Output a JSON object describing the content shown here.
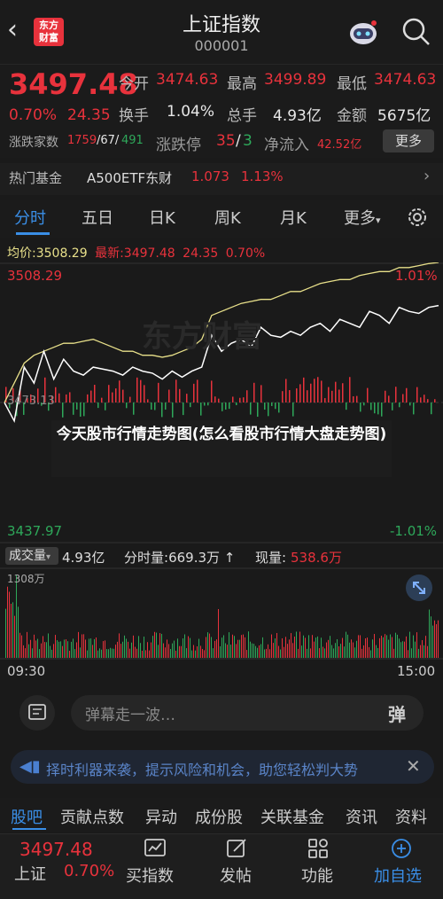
{
  "header": {
    "back_icon": "chevron-left-icon",
    "logo_line1": "东方",
    "logo_line2": "财富",
    "title": "上证指数",
    "code": "000001"
  },
  "quote": {
    "price": "3497.48",
    "pct": "0.70%",
    "change": "24.35",
    "open_label": "今开",
    "open": "3474.63",
    "high_label": "最高",
    "high": "3499.89",
    "low_label": "最低",
    "low": "3474.63",
    "turnover_label": "换手",
    "turnover": "1.04%",
    "volume_label": "总手",
    "volume": "4.93亿",
    "amount_label": "金额",
    "amount": "5675亿",
    "breadth_label": "涨跌家数",
    "up_count": "1759",
    "flat_count": "/67/",
    "down_count": "491",
    "limit_label": "涨跌停",
    "limit_up": "35",
    "limit_sep": "/",
    "limit_down": "3",
    "inflow_label": "净流入",
    "inflow": "42.52亿",
    "more_label": "更多"
  },
  "fund": {
    "label": "热门基金",
    "name": "A500ETF东财",
    "price": "1.073",
    "pct": "1.13%"
  },
  "tabs": [
    "分时",
    "五日",
    "日K",
    "周K",
    "月K",
    "更多"
  ],
  "chart_info": {
    "avg_label": "均价:",
    "avg": "3508.29",
    "latest_label": "最新:",
    "latest": "3497.48",
    "latest_change": "24.35",
    "latest_pct": "0.70%"
  },
  "chart_labels": {
    "high": "3508.29",
    "high_pct": "1.01%",
    "low": "3437.97",
    "low_pct": "-1.01%",
    "prev_close": "3473.13",
    "watermark": "东方财富"
  },
  "caption": "今天股市行情走势图(怎么看股市行情大盘走势图)",
  "volume_row": {
    "tag": "成交量",
    "total": "4.93亿",
    "minute_label": "分时量:",
    "minute": "669.3万",
    "now_label": "现量:",
    "now": "538.6万",
    "max": "1308万"
  },
  "time_axis": {
    "start": "09:30",
    "end": "15:00"
  },
  "danmaku": {
    "placeholder": "弹幕走一波…",
    "button": "弹"
  },
  "banner": {
    "text": "择时利器来袭，提示风险和机会，助您轻松判大势"
  },
  "bottom_tabs": [
    "股吧",
    "贡献点数",
    "异动",
    "成份股",
    "关联基金",
    "资讯",
    "资料"
  ],
  "bottom_nav": {
    "price": "3497.48",
    "name": "上证",
    "pct": "0.70%",
    "items": [
      "买指数",
      "发帖",
      "功能",
      "加自选"
    ]
  },
  "colors": {
    "up": "#e8323c",
    "down": "#2ea85a",
    "accent": "#3a8ee6",
    "price_line": "#ffffff",
    "avg_line": "#e8e08a"
  },
  "chart_data": {
    "type": "line",
    "series": [
      {
        "values": [
          3473.1,
          3468.5,
          3482.0,
          3478.0,
          3486.0,
          3479.0,
          3484.0,
          3481.0,
          3480.0,
          3482.0,
          3481.5,
          3481.0,
          3480.0,
          3482.0,
          3481.0,
          3480.5,
          3479.0,
          3481.0,
          3479.5,
          3481.0,
          3482.0,
          3490.0,
          3486.0,
          3488.0,
          3489.0,
          3487.0,
          3492.0,
          3490.0,
          3489.5,
          3491.0,
          3490.0,
          3492.0,
          3493.0,
          3491.0,
          3494.0,
          3493.0,
          3492.0,
          3496.0,
          3495.0,
          3493.0,
          3497.0,
          3496.0,
          3495.5,
          3497.0,
          3497.48
        ]
      },
      {
        "values": [
          3473.1,
          3478.0,
          3483.0,
          3485.0,
          3486.0,
          3487.0,
          3488.0,
          3488.0,
          3488.5,
          3489.0,
          3488.0,
          3487.0,
          3486.0,
          3486.0,
          3485.0,
          3485.0,
          3484.5,
          3485.0,
          3486.0,
          3487.0,
          3489.0,
          3495.0,
          3496.0,
          3497.0,
          3498.0,
          3498.5,
          3499.0,
          3499.0,
          3500.0,
          3501.0,
          3501.0,
          3502.0,
          3503.0,
          3503.5,
          3504.0,
          3504.0,
          3505.0,
          3505.5,
          3506.0,
          3506.0,
          3507.0,
          3507.0,
          3507.5,
          3508.0,
          3508.29
        ]
      }
    ],
    "ylim": [
      3437.97,
      3508.29
    ]
  }
}
